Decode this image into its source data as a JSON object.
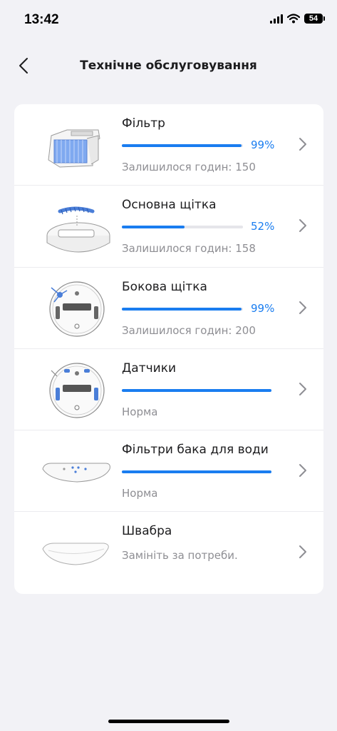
{
  "status_bar": {
    "time": "13:42",
    "battery": "54"
  },
  "nav": {
    "title": "Технічне обслуговування"
  },
  "items": [
    {
      "title": "Фільтр",
      "progress": 0.99,
      "percent": "99%",
      "subtitle": "Залишилося годин: 150",
      "icon": "filter-icon"
    },
    {
      "title": "Основна щітка",
      "progress": 0.52,
      "percent": "52%",
      "subtitle": "Залишилося годин: 158",
      "icon": "main-brush-icon"
    },
    {
      "title": "Бокова щітка",
      "progress": 0.99,
      "percent": "99%",
      "subtitle": "Залишилося годин: 200",
      "icon": "side-brush-icon"
    },
    {
      "title": "Датчики",
      "progress": 1.0,
      "subtitle": "Норма",
      "icon": "sensors-icon"
    },
    {
      "title": "Фільтри бака для води",
      "progress": 1.0,
      "subtitle": "Норма",
      "icon": "water-tank-filter-icon"
    },
    {
      "title": "Швабра",
      "subtitle": "Замініть за потреби.",
      "icon": "mop-icon"
    }
  ],
  "colors": {
    "accent": "#1a7df0",
    "track": "#e5e5ea",
    "background": "#f2f2f6",
    "card": "#ffffff"
  }
}
